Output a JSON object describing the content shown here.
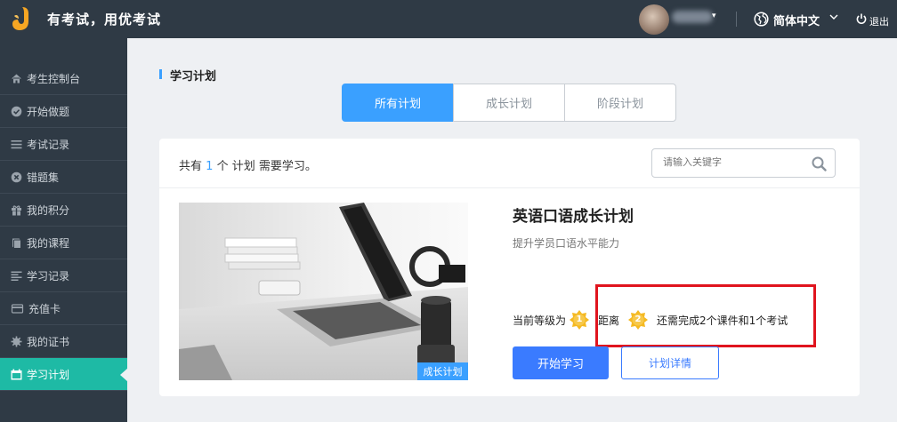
{
  "header": {
    "app_title": "有考试，用优考试",
    "language": "简体中文",
    "logout": "退出"
  },
  "sidebar": {
    "items": [
      {
        "label": "考生控制台",
        "icon": "home-icon",
        "active": false
      },
      {
        "label": "开始做题",
        "icon": "check-circle-icon",
        "active": false
      },
      {
        "label": "考试记录",
        "icon": "list-icon",
        "active": false
      },
      {
        "label": "错题集",
        "icon": "x-circle-icon",
        "active": false
      },
      {
        "label": "我的积分",
        "icon": "gift-icon",
        "active": false
      },
      {
        "label": "我的课程",
        "icon": "book-icon",
        "active": false
      },
      {
        "label": "学习记录",
        "icon": "align-left-icon",
        "active": false
      },
      {
        "label": "充值卡",
        "icon": "card-icon",
        "active": false
      },
      {
        "label": "我的证书",
        "icon": "certificate-icon",
        "active": false
      },
      {
        "label": "学习计划",
        "icon": "calendar-icon",
        "active": true
      }
    ]
  },
  "main": {
    "section_title": "学习计划",
    "tabs": [
      {
        "label": "所有计划",
        "active": true
      },
      {
        "label": "成长计划",
        "active": false
      },
      {
        "label": "阶段计划",
        "active": false
      }
    ],
    "summary": {
      "prefix": "共有",
      "count": "1",
      "suffix": "个 计划 需要学习。"
    },
    "search": {
      "placeholder": "请输入关键字",
      "value": ""
    },
    "plan": {
      "thumbnail_badge": "成长计划",
      "title": "英语口语成长计划",
      "description": "提升学员口语水平能力",
      "level_label": "当前等级为",
      "current_level": "1",
      "distance_label": "距离",
      "next_level": "2",
      "requirement": "还需完成2个课件和1个考试",
      "start_button": "开始学习",
      "detail_button": "计划详情"
    }
  },
  "colors": {
    "topbar": "#2f3a45",
    "sidebar_active": "#1ebaa5",
    "accent": "#3aa0ff",
    "primary_button": "#3a7bff",
    "highlight_border": "#e0141e",
    "medal": "#f5b921"
  }
}
